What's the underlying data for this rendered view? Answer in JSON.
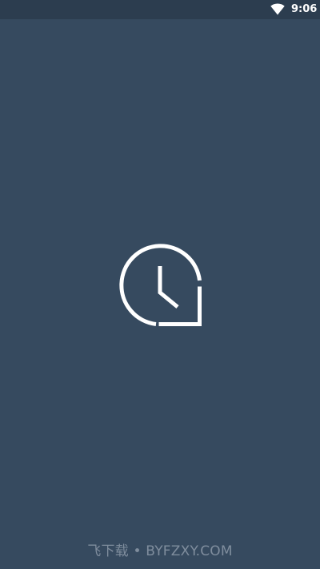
{
  "status_bar": {
    "time": "9:06",
    "wifi_icon": "wifi-icon"
  },
  "splash": {
    "logo_icon": "clock-icon"
  },
  "watermark": {
    "text": "飞下载 • BYFZXY.COM"
  },
  "colors": {
    "background": "#364a5f",
    "status_bar": "#2c3d4f",
    "logo": "#ffffff",
    "watermark": "#7f8d9d"
  }
}
